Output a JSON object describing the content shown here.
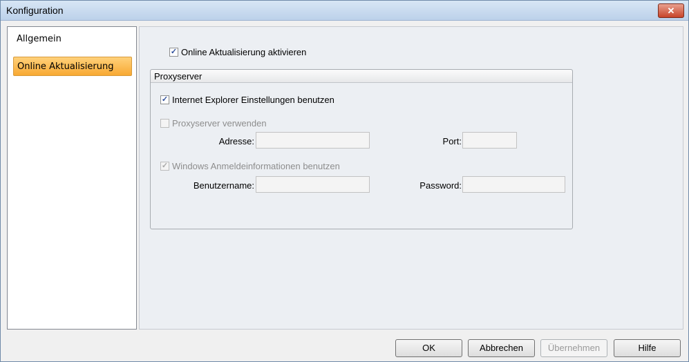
{
  "window": {
    "title": "Konfiguration",
    "close_label": "✕"
  },
  "sidebar": {
    "items": [
      {
        "label": "Allgemein",
        "selected": false
      },
      {
        "label": "Online Aktualisierung",
        "selected": true
      }
    ]
  },
  "main": {
    "online_update_checkbox": {
      "label": "Online Aktualisierung aktivieren",
      "checked": true,
      "check_glyph": "✓"
    },
    "proxy_group": {
      "title": "Proxyserver",
      "use_ie_settings": {
        "label": "Internet Explorer Einstellungen benutzen",
        "checked": true,
        "check_glyph": "✓"
      },
      "use_proxy": {
        "label": "Proxyserver verwenden",
        "checked": false,
        "enabled": false
      },
      "address": {
        "label": "Adresse:",
        "value": ""
      },
      "port": {
        "label": "Port:",
        "value": ""
      },
      "use_windows_credentials": {
        "label": "Windows Anmeldeinformationen benutzen",
        "checked": true,
        "enabled": false,
        "check_glyph": "✓"
      },
      "username": {
        "label": "Benutzername:",
        "value": ""
      },
      "password": {
        "label": "Password:",
        "value": ""
      }
    }
  },
  "footer": {
    "ok_label": "OK",
    "cancel_label": "Abbrechen",
    "apply_label": "Übernehmen",
    "help_label": "Hilfe"
  },
  "colors": {
    "selected_nav": "#f8a933",
    "close_button": "#c7442a",
    "titlebar": "#bcd1ea"
  }
}
